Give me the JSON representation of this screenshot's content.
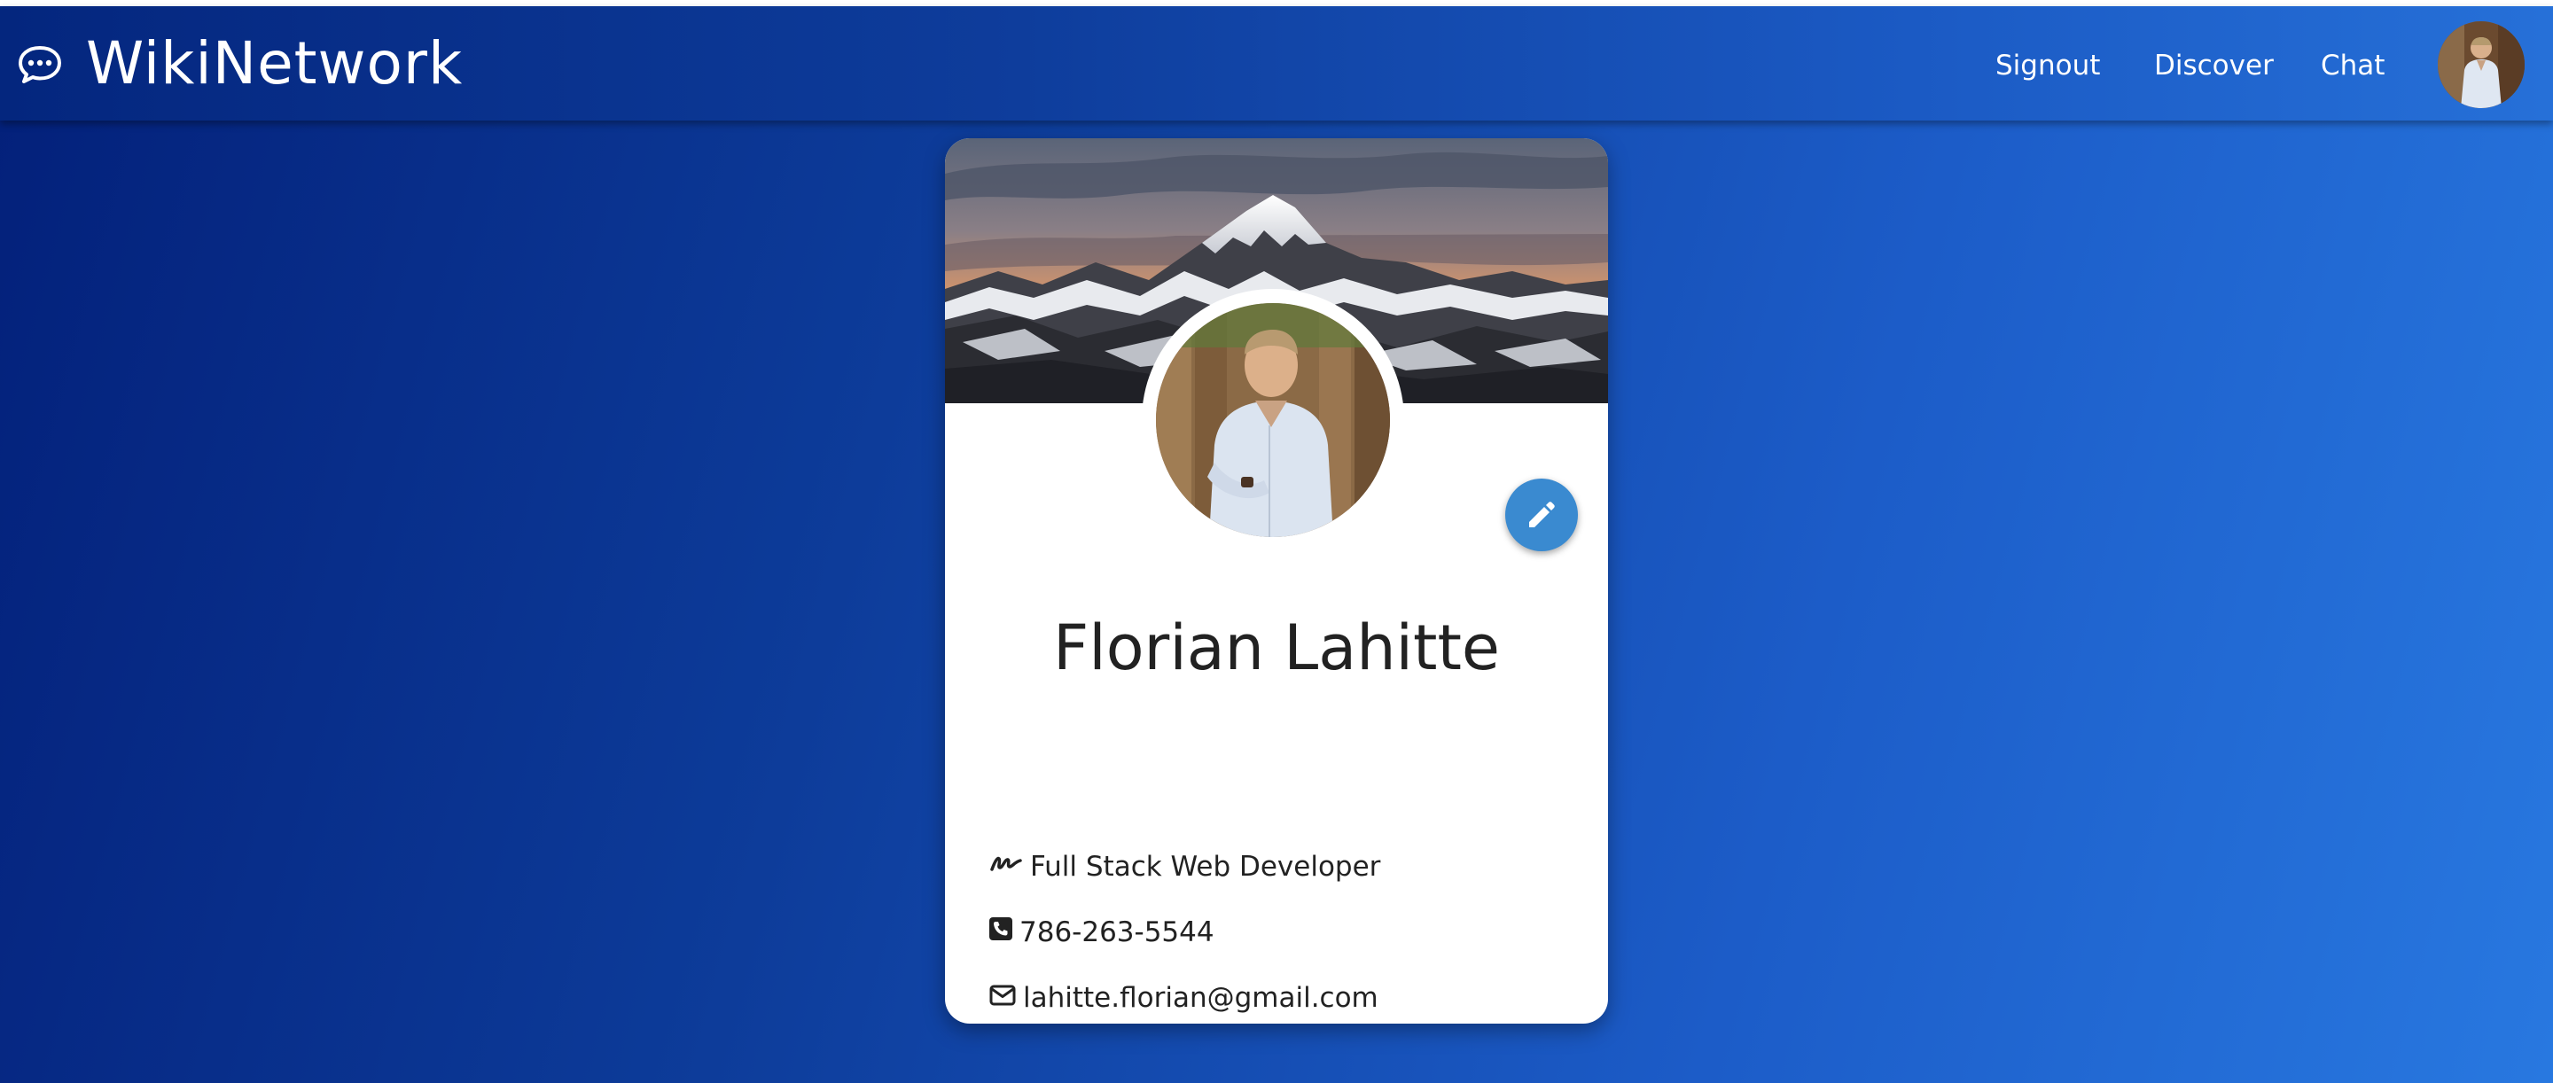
{
  "navbar": {
    "brand": "WikiNetwork",
    "brand_icon": "chat-bubble-icon",
    "links": {
      "signout": "Signout",
      "discover": "Discover",
      "chat": "Chat"
    },
    "avatar": "user-avatar"
  },
  "profile": {
    "name": "Florian Lahitte",
    "title": "Full Stack Web Developer",
    "phone": "786-263-5544",
    "email": "lahitte.florian@gmail.com",
    "icons": {
      "title": "signature-icon",
      "phone": "phone-square-icon",
      "email": "envelope-icon",
      "edit": "pencil-icon"
    }
  },
  "colors": {
    "gradient_dark": "#03207a",
    "gradient_light": "#2878e0",
    "edit_button": "#3a8ad0",
    "text": "#222222"
  }
}
